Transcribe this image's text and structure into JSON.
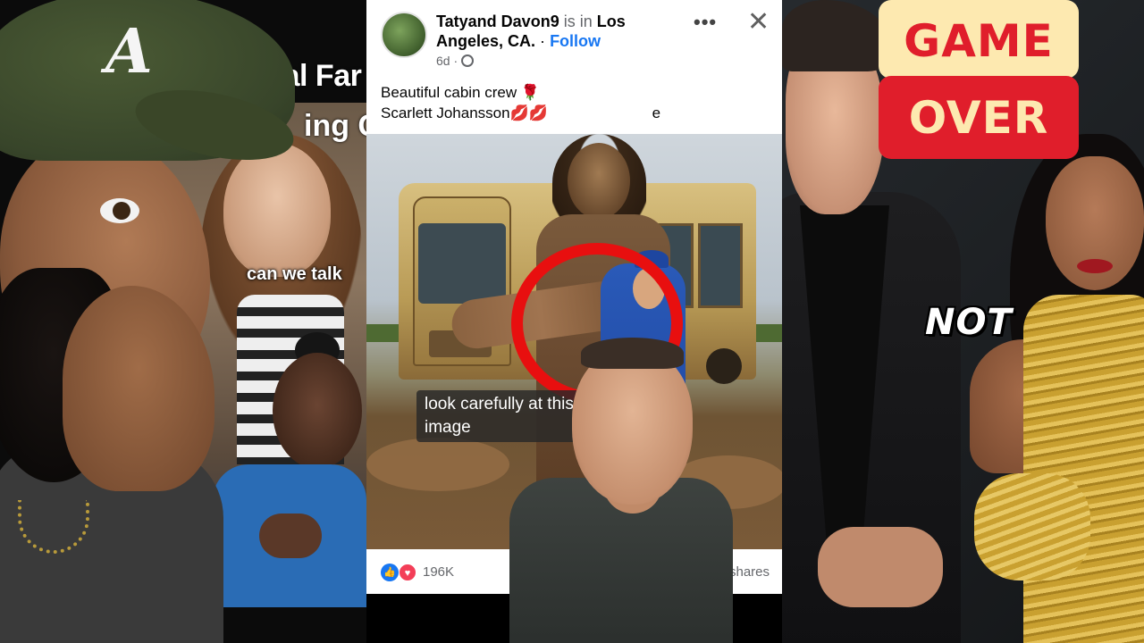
{
  "left_panel": {
    "title": "The Royal Far",
    "subtitle": "ing G",
    "caption": "can we talk",
    "cap_logo": "A"
  },
  "post": {
    "author": "Tatyand Davon9",
    "is_in": "is in",
    "location": "Los Angeles, CA.",
    "separator": "·",
    "follow": "Follow",
    "time": "6d",
    "more_icon": "•••",
    "close_icon": "✕",
    "text_line1": "Beautiful cabin crew",
    "rose_emoji": "🌹",
    "text_line2": "Scarlett Johansson",
    "lips_emoji": "💋💋",
    "text_line2_tail": "e",
    "image_caption": "look carefully at this image",
    "reaction_count": "196K",
    "shares": "shares",
    "like_icon": "👍",
    "love_icon": "♥"
  },
  "right_panel": {
    "game": "GAME",
    "over": "OVER",
    "not": "NOT"
  },
  "colors": {
    "facebook_blue": "#1877f2",
    "highlight_red": "#e80f0f",
    "game_over_red": "#e01e2b",
    "game_over_cream": "#fde9b0"
  }
}
